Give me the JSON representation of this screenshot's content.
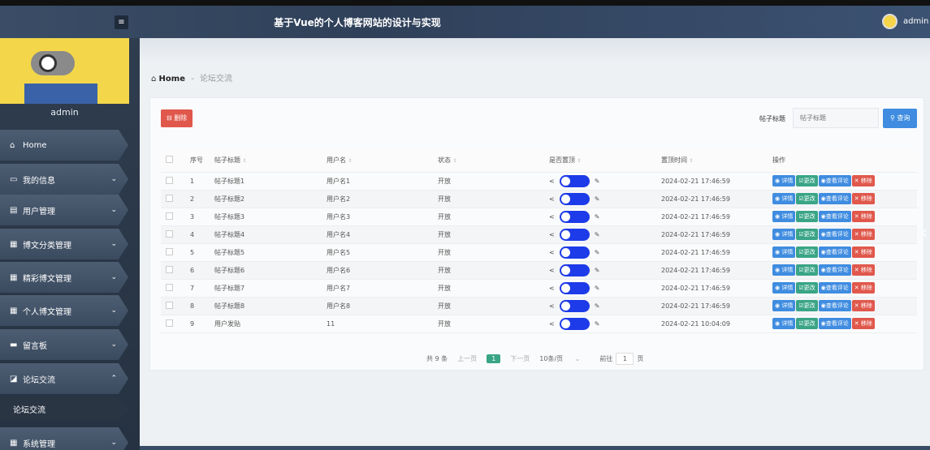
{
  "header": {
    "app_title": "基于Vue的个人博客网站的设计与实现",
    "user_name": "admin",
    "menu_toggle_icon": "menu-icon"
  },
  "sidebar": {
    "user_name": "admin",
    "items": [
      {
        "label": "Home",
        "icon": "home-icon"
      },
      {
        "label": "我的信息",
        "icon": "window-icon"
      },
      {
        "label": "用户管理",
        "icon": "clipboard-icon"
      },
      {
        "label": "博文分类管理",
        "icon": "grid-icon"
      },
      {
        "label": "精彩博文管理",
        "icon": "grid-icon"
      },
      {
        "label": "个人博文管理",
        "icon": "grid-icon"
      },
      {
        "label": "留言板",
        "icon": "monitor-icon"
      },
      {
        "label": "论坛交流",
        "icon": "share-icon"
      },
      {
        "label": "系统管理",
        "icon": "grid-icon"
      }
    ],
    "sub_items": [
      {
        "label": "论坛交流"
      }
    ]
  },
  "breadcrumb": {
    "home": "Home",
    "separator": "-",
    "current": "论坛交流"
  },
  "toolbar": {
    "delete_label": "删除",
    "search_label": "帖子标题",
    "search_placeholder": "帖子标题",
    "query_label": "查询"
  },
  "table": {
    "headers": [
      "序号",
      "帖子标题",
      "用户名",
      "状态",
      "是否置顶",
      "置顶时间",
      "操作"
    ],
    "actions": {
      "detail": "详情",
      "edit": "更改",
      "comments": "查看评论",
      "remove": "移除"
    },
    "rows": [
      {
        "no": "1",
        "title": "帖子标题1",
        "user": "用户名1",
        "status": "开放",
        "pinned": true,
        "time": "2024-02-21 17:46:59"
      },
      {
        "no": "2",
        "title": "帖子标题2",
        "user": "用户名2",
        "status": "开放",
        "pinned": true,
        "time": "2024-02-21 17:46:59"
      },
      {
        "no": "3",
        "title": "帖子标题3",
        "user": "用户名3",
        "status": "开放",
        "pinned": true,
        "time": "2024-02-21 17:46:59"
      },
      {
        "no": "4",
        "title": "帖子标题4",
        "user": "用户名4",
        "status": "开放",
        "pinned": true,
        "time": "2024-02-21 17:46:59"
      },
      {
        "no": "5",
        "title": "帖子标题5",
        "user": "用户名5",
        "status": "开放",
        "pinned": true,
        "time": "2024-02-21 17:46:59"
      },
      {
        "no": "6",
        "title": "帖子标题6",
        "user": "用户名6",
        "status": "开放",
        "pinned": true,
        "time": "2024-02-21 17:46:59"
      },
      {
        "no": "7",
        "title": "帖子标题7",
        "user": "用户名7",
        "status": "开放",
        "pinned": true,
        "time": "2024-02-21 17:46:59"
      },
      {
        "no": "8",
        "title": "帖子标题8",
        "user": "用户名8",
        "status": "开放",
        "pinned": true,
        "time": "2024-02-21 17:46:59"
      },
      {
        "no": "9",
        "title": "用户发贴",
        "user": "11",
        "status": "开放",
        "pinned": true,
        "time": "2024-02-21 10:04:09"
      }
    ]
  },
  "pagination": {
    "total": "共 9 条",
    "prev": "上一页",
    "current": "1",
    "next": "下一页",
    "page_size": "10条/页",
    "goto_label": "前往",
    "goto_value": "1",
    "page_unit": "页"
  },
  "colors": {
    "danger": "#e0584c",
    "primary": "#3f8ce0",
    "success": "#3aa586",
    "switch_on": "#1d3be8"
  }
}
